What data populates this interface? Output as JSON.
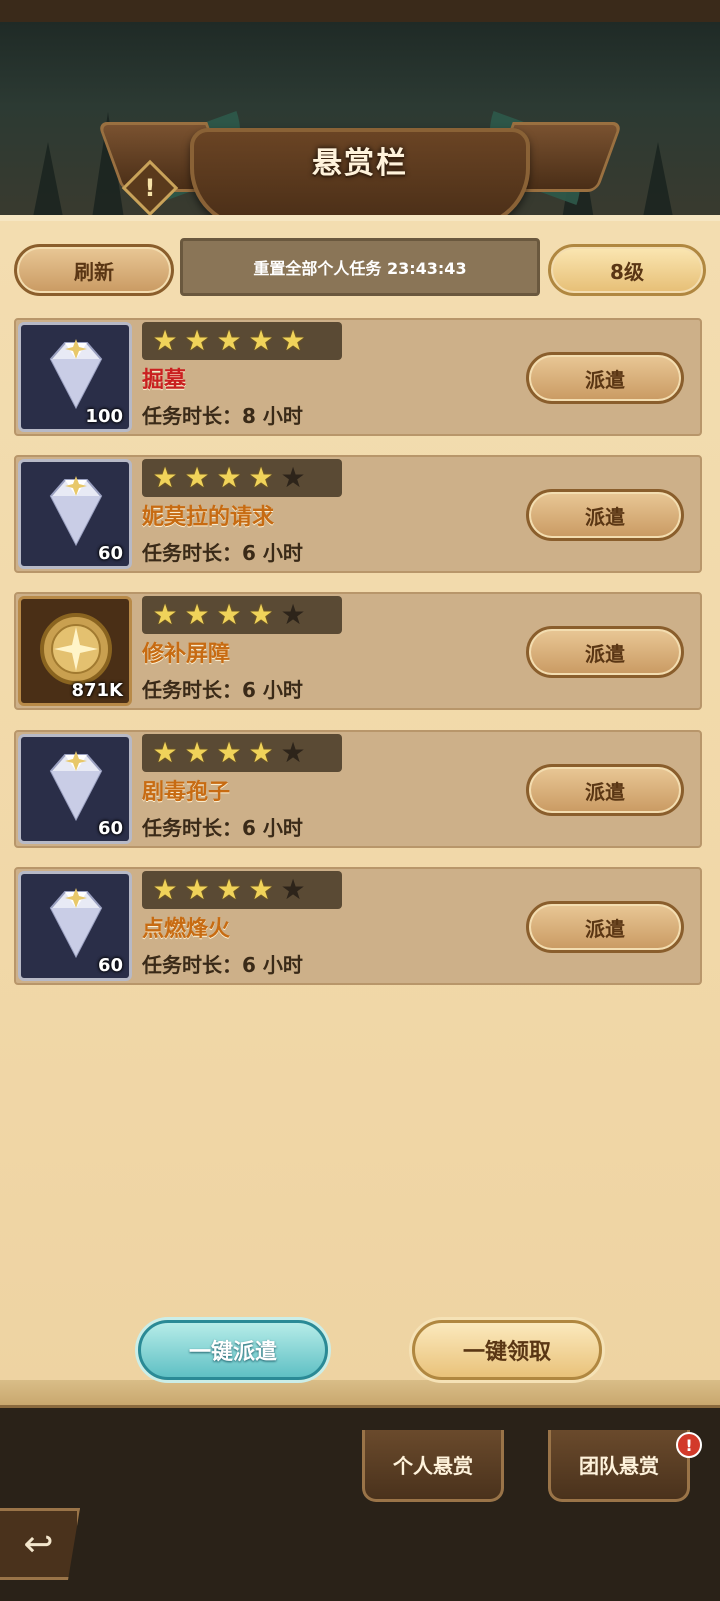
{
  "title": "悬赏栏",
  "header": {
    "refresh_label": "刷新",
    "reset_text": "重置全部个人任务 23:43:43",
    "level_label": "8级"
  },
  "quests": [
    {
      "name": "掘墓",
      "name_color": "red",
      "stars": 5,
      "reward_icon": "diamond-icon",
      "reward_count": "100",
      "duration": "任务时长：8 小时",
      "dispatch_label": "派遣"
    },
    {
      "name": "妮莫拉的请求",
      "name_color": "orange",
      "stars": 4,
      "reward_icon": "diamond-icon",
      "reward_count": "60",
      "duration": "任务时长：6 小时",
      "dispatch_label": "派遣"
    },
    {
      "name": "修补屏障",
      "name_color": "orange",
      "stars": 4,
      "reward_icon": "gold-coin-icon",
      "reward_count": "871K",
      "duration": "任务时长：6 小时",
      "dispatch_label": "派遣"
    },
    {
      "name": "剧毒孢子",
      "name_color": "orange",
      "stars": 4,
      "reward_icon": "diamond-icon",
      "reward_count": "60",
      "duration": "任务时长：6 小时",
      "dispatch_label": "派遣"
    },
    {
      "name": "点燃烽火",
      "name_color": "orange",
      "stars": 4,
      "reward_icon": "diamond-icon",
      "reward_count": "60",
      "duration": "任务时长：6 小时",
      "dispatch_label": "派遣"
    }
  ],
  "max_stars": 5,
  "actions": {
    "dispatch_all_label": "一键派遣",
    "claim_all_label": "一键领取"
  },
  "tabs": {
    "personal_label": "个人悬赏",
    "team_label": "团队悬赏",
    "team_badge": "!"
  },
  "colors": {
    "accent_orange": "#c76b12",
    "accent_red": "#c92020",
    "star_on": "#f0d35a"
  }
}
